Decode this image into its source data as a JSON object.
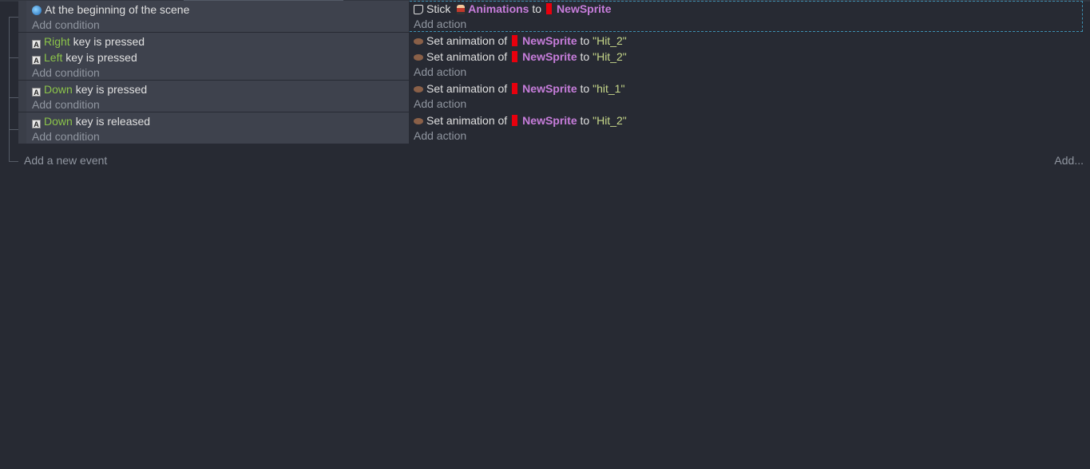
{
  "events": [
    {
      "conditions": [
        {
          "icon": "scene-icon",
          "text": "At the beginning of the scene"
        }
      ],
      "actions": [
        {
          "icon": "stick-icon",
          "prefix": "Stick",
          "obj1": "Animations",
          "mid": "to",
          "obj2": "NewSprite"
        }
      ]
    },
    {
      "conditions": [
        {
          "icon": "keyboard-icon",
          "key": "Right",
          "text": "key is pressed"
        },
        {
          "icon": "keyboard-icon",
          "key": "Left",
          "text": "key is pressed"
        }
      ],
      "actions": [
        {
          "icon": "set-animation-icon",
          "prefix": "Set animation of",
          "obj": "NewSprite",
          "mid": "to",
          "value": "\"Hit_2\""
        },
        {
          "icon": "set-animation-icon",
          "prefix": "Set animation of",
          "obj": "NewSprite",
          "mid": "to",
          "value": "\"Hit_2\""
        }
      ]
    },
    {
      "conditions": [
        {
          "icon": "keyboard-icon",
          "key": "Down",
          "text": "key is pressed"
        }
      ],
      "actions": [
        {
          "icon": "set-animation-icon",
          "prefix": "Set animation of",
          "obj": "NewSprite",
          "mid": "to",
          "value": "\"hit_1\""
        }
      ]
    },
    {
      "conditions": [
        {
          "icon": "keyboard-icon",
          "key": "Down",
          "text": "key is released"
        }
      ],
      "actions": [
        {
          "icon": "set-animation-icon",
          "prefix": "Set animation of",
          "obj": "NewSprite",
          "mid": "to",
          "value": "\"Hit_2\""
        }
      ]
    }
  ],
  "labels": {
    "add_condition": "Add condition",
    "add_action": "Add action",
    "add_new_event": "Add a new event",
    "add_menu": "Add...",
    "key_icon_glyph": "A"
  },
  "colors": {
    "background": "#272a33",
    "key_name": "#8bc34a",
    "object_name": "#c77ddb",
    "string_value": "#c7d88a",
    "object_icon": "#e8000d",
    "selection_outline": "#3d8fb0"
  }
}
